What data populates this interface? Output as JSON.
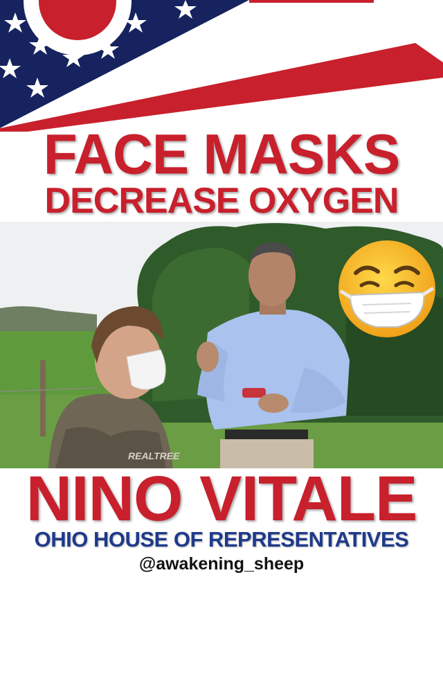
{
  "banner": {
    "icon": "ohio-flag"
  },
  "headline": {
    "line1": "FACE MASKS",
    "line2": "DECREASE OXYGEN"
  },
  "photo": {
    "description_icon": "photo-man-and-boy-outdoors",
    "emoji": "face-with-medical-mask-emoji",
    "colors": {
      "shirt": "#a9c2ee",
      "sky": "#eef0f2",
      "field": "#5f9a3c",
      "trees": "#2f5a2a"
    }
  },
  "caption": {
    "name": "NINO VITALE",
    "subtitle": "OHIO HOUSE OF REPRESENTATIVES",
    "handle": "@awakening_sheep"
  },
  "colors": {
    "accent": "#c8202c",
    "navy": "#1f3a8a",
    "background": "#ffffff"
  }
}
